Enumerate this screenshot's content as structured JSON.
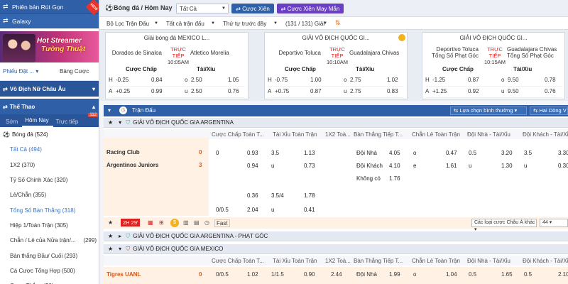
{
  "sidebar": {
    "headers": [
      "Phiên bản Rút Gọn",
      "Galaxy"
    ],
    "banner": {
      "line1": "Hot Streamer",
      "line2": "Tường Thuật",
      "badge": "NEW"
    },
    "filter_left": "Phiếu Đặt ...",
    "filter_right": "Bảng Cược",
    "section1": "Vô Địch Nữ Châu Âu",
    "section2": "Thể Thao",
    "tabs": [
      "Sớm",
      "Hôm Nay",
      "Trực tiếp"
    ],
    "live_count": "112",
    "sport": {
      "label": "Bóng đá",
      "count": "(524)"
    },
    "items": [
      {
        "label": "Tất Cả (494)",
        "hl": true
      },
      {
        "label": "1X2 (370)"
      },
      {
        "label": "Tỷ Số Chính Xác (320)"
      },
      {
        "label": "Lẻ/Chẵn (355)"
      },
      {
        "label": "Tổng Số Bàn Thắng (318)",
        "hl": true
      },
      {
        "label": "Hiệp 1/Toàn Trận (305)"
      },
      {
        "label": "Chẵn / Lẻ của Nửa trận/...",
        "right": "(299)"
      },
      {
        "label": "Bàn thắng Đầu/ Cuối (293)"
      },
      {
        "label": "Cá Cược Tổng Hợp (500)"
      },
      {
        "label": "Cược Thắng (30)"
      }
    ]
  },
  "topbar": {
    "title": "Bóng đá / Hôm Nay",
    "filter_all": "Tất Cả",
    "btn_parlay": "Cược Xiên",
    "btn_lucky": "Cược Xiên May Mắn",
    "filter_match": "Bộ Lọc Trận Đấu",
    "all_matches": "Tất cả trận đấu",
    "order": "Thứ tự trước đây",
    "count": "(131 / 131) Giải"
  },
  "cards": [
    {
      "league": "Giải bóng đá MEXICO L...",
      "home": "Dorados de Sinaloa",
      "away": "Atletico Morelia",
      "live": "TRỰC TIẾP",
      "time": "10:05AM",
      "hdr_hc": "Cược Chấp",
      "hdr_ou": "Tài/Xỉu",
      "rows": [
        [
          "H",
          "-0.25",
          "0.84",
          "o",
          "2.50",
          "1.05"
        ],
        [
          "A",
          "+0.25",
          "0.99",
          "u",
          "2.50",
          "0.76"
        ]
      ]
    },
    {
      "league": "GIẢI VÔ ĐỊCH QUỐC GI...",
      "home": "Deportivo Toluca",
      "away": "Guadalajara Chivas",
      "live": "TRỰC TIẾP",
      "time": "10:10AM",
      "hdr_hc": "Cược Chấp",
      "hdr_ou": "Tài/Xỉu",
      "rows": [
        [
          "H",
          "-0.75",
          "1.00",
          "o",
          "2.75",
          "1.02"
        ],
        [
          "A",
          "+0.75",
          "0.87",
          "u",
          "2.75",
          "0.83"
        ]
      ]
    },
    {
      "league": "GIẢI VÔ ĐỊCH QUỐC GI...",
      "home": "Deportivo Toluca Tổng Số Phạt Góc",
      "away": "Guadalajara Chivas Tổng Số Phạt Góc",
      "live": "TRỰC TIẾP",
      "time": "10:15AM",
      "hdr_hc": "Cược Chấp",
      "hdr_ou": "Tài/Xỉu",
      "rows": [
        [
          "H",
          "-1.25",
          "0.87",
          "o",
          "9.50",
          "0.78"
        ],
        [
          "A",
          "+1.25",
          "0.92",
          "u",
          "9.50",
          "0.76"
        ]
      ]
    }
  ],
  "main": {
    "section": "Trận Đấu",
    "sort": "Lựa chọn bình thường",
    "view": "Hai Dòng V",
    "league1": "GIẢI VÔ ĐỊCH QUỐC GIA ARGENTINA",
    "cols": [
      "Cược Chấp Toàn T...",
      "Tài Xỉu Toàn Trận",
      "1X2 Toà...",
      "Bàn Thắng Tiếp T...",
      "Chẵn Lẻ Toàn Trận",
      "Đội Nhà - Tài/Xỉu",
      "Đội Khách - Tài/Xỉu"
    ],
    "match1": {
      "home": "Racing Club",
      "away": "Argentinos Juniors",
      "hs": "0",
      "as": "3"
    },
    "m1rows": [
      [
        "0",
        "0.93",
        "3.5",
        "1.13",
        "Đội Nhà",
        "4.05",
        "o",
        "0.47",
        "0.5",
        "3.20",
        "3.5",
        "3.30"
      ],
      [
        "",
        "0.94",
        "u",
        "0.73",
        "Đội Khách",
        "4.10",
        "e",
        "1.61",
        "u",
        "1.30",
        "u",
        "0.30"
      ],
      [
        "",
        "",
        "",
        "",
        "Không có",
        "1.76",
        "",
        "",
        "",
        "",
        "",
        ""
      ],
      [
        "",
        "0.36",
        "3.5/4",
        "1.78",
        "",
        "",
        "",
        "",
        "",
        "",
        "",
        ""
      ],
      [
        "0/0.5",
        "2.04",
        "u",
        "0.41",
        "",
        "",
        "",
        "",
        "",
        "",
        "",
        ""
      ]
    ],
    "tool_time": "2H 29'",
    "tool_fast": "Fast",
    "other_bets": "Các loại cược Châu Á khác",
    "page_n": "44",
    "league2": "GIẢI VÔ ĐỊCH QUỐC GIA ARGENTINA - PHẠT GÓC",
    "league3": "GIẢI VÔ ĐỊCH QUỐC GIA MEXICO",
    "match2": {
      "home": "Tigres UANL",
      "hs": "0",
      "vals": [
        "0/0.5",
        "1.02",
        "1/1.5",
        "0.90",
        "2.44",
        "Đội Nhà",
        "1.99",
        "o",
        "1.04",
        "0.5",
        "1.65",
        "0.5",
        "2.10"
      ]
    }
  }
}
